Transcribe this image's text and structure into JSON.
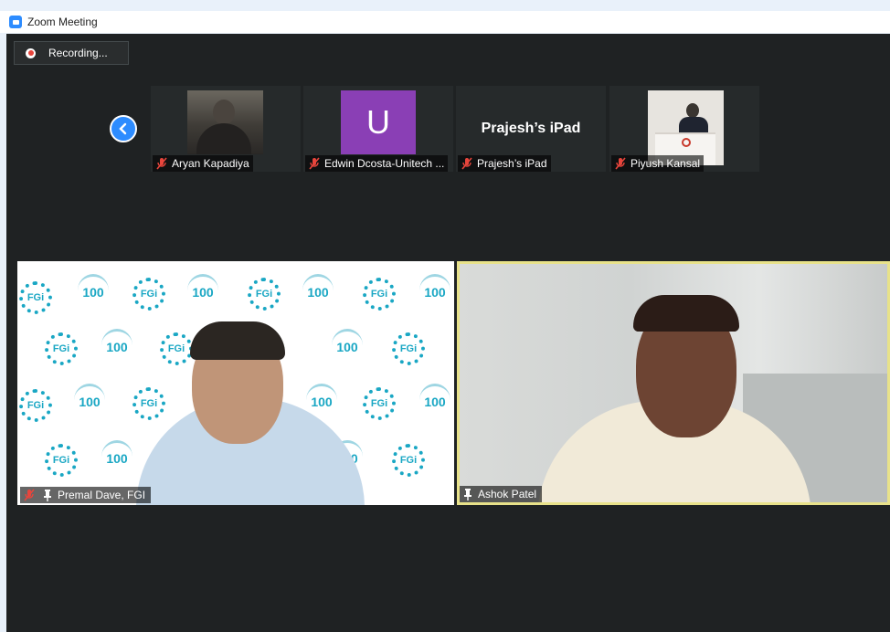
{
  "window": {
    "title": "Zoom Meeting"
  },
  "recording": {
    "label": "Recording..."
  },
  "gallery": {
    "tiles": [
      {
        "name": "Aryan Kapadiya",
        "muted": true
      },
      {
        "name": "Edwin Dcosta-Unitech ...",
        "avatar_letter": "U",
        "avatar_color": "#8a3fb5",
        "muted": true
      },
      {
        "name": "Prajesh’s iPad",
        "display_text": "Prajesh’s iPad",
        "muted": true
      },
      {
        "name": "Piyush Kansal",
        "muted": true
      }
    ]
  },
  "main_videos": [
    {
      "name": "Premal Dave, FGI",
      "muted": true,
      "pinned": true,
      "backdrop_text_a": "FGi",
      "backdrop_text_b": "100"
    },
    {
      "name": "Ashok Patel",
      "pinned": true,
      "active_speaker": true
    }
  ],
  "colors": {
    "accent": "#2d8cff",
    "speaker_border": "#e8e28a",
    "muted_icon": "#e8453c",
    "stage_bg": "#1f2223"
  }
}
